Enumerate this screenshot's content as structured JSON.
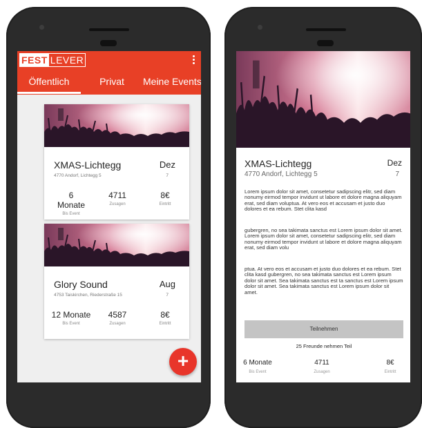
{
  "app": {
    "logo_part1": "FEST",
    "logo_part2": "LEVER"
  },
  "tabs": [
    {
      "label": "Öffentlich",
      "active": true
    },
    {
      "label": "Privat"
    },
    {
      "label": "Meine Events"
    }
  ],
  "events": [
    {
      "title": "XMAS-Lichtegg",
      "address": "4770 Andorf, Lichtegg 5",
      "month": "Dez",
      "day": "7",
      "stats": [
        {
          "value": "6 Monate",
          "label": "Bis Event"
        },
        {
          "value": "4711",
          "label": "Zusagen"
        },
        {
          "value": "8€",
          "label": "Eintritt"
        }
      ]
    },
    {
      "title": "Glory Sound",
      "address": "4753 Taiskirchen, Riederstraße 15",
      "month": "Aug",
      "day": "7",
      "stats": [
        {
          "value": "12 Monate",
          "label": "Bis Event"
        },
        {
          "value": "4587",
          "label": "Zusagen"
        },
        {
          "value": "8€",
          "label": "Eintritt"
        }
      ]
    }
  ],
  "fab_label": "+",
  "detail": {
    "title": "XMAS-Lichtegg",
    "address": "4770 Andorf, Lichtegg 5",
    "month": "Dez",
    "day": "7",
    "paragraphs": [
      "Lorem ipsum dolor sit amet, consetetur sadipscing elitr, sed diam nonumy eirmod tempor invidunt ut labore et dolore magna aliquyam erat, sed diam voluptua. At vero eos et accusam et justo duo dolores et ea rebum. Stet clita kasd",
      "gubergren, no sea takimata sanctus est Lorem ipsum dolor sit amet. Lorem ipsum dolor sit amet, consetetur sadipscing elitr, sed diam nonumy eirmod tempor invidunt ut labore et dolore magna aliquyam erat, sed diam volu",
      "ptua. At vero eos et accusam et justo duo dolores et ea rebum. Stet clita kasd gubergren, no sea takimata sanctus est Lorem ipsum dolor sit amet. Sea takimata sanctus est ta sanctus est Lorem ipsum dolor sit amet. Sea takimata sanctus est Lorem ipsum dolor sit amet."
    ],
    "join_label": "Teilnehmen",
    "friends_text": "25 Freunde nehmen Teil",
    "stats": [
      {
        "value": "6 Monate",
        "label": "Bis Event"
      },
      {
        "value": "4711",
        "label": "Zusagen"
      },
      {
        "value": "8€",
        "label": "Eintritt"
      }
    ]
  },
  "colors": {
    "accent": "#e84026",
    "fab": "#e8352a",
    "phone_body": "#2b2b2b"
  }
}
